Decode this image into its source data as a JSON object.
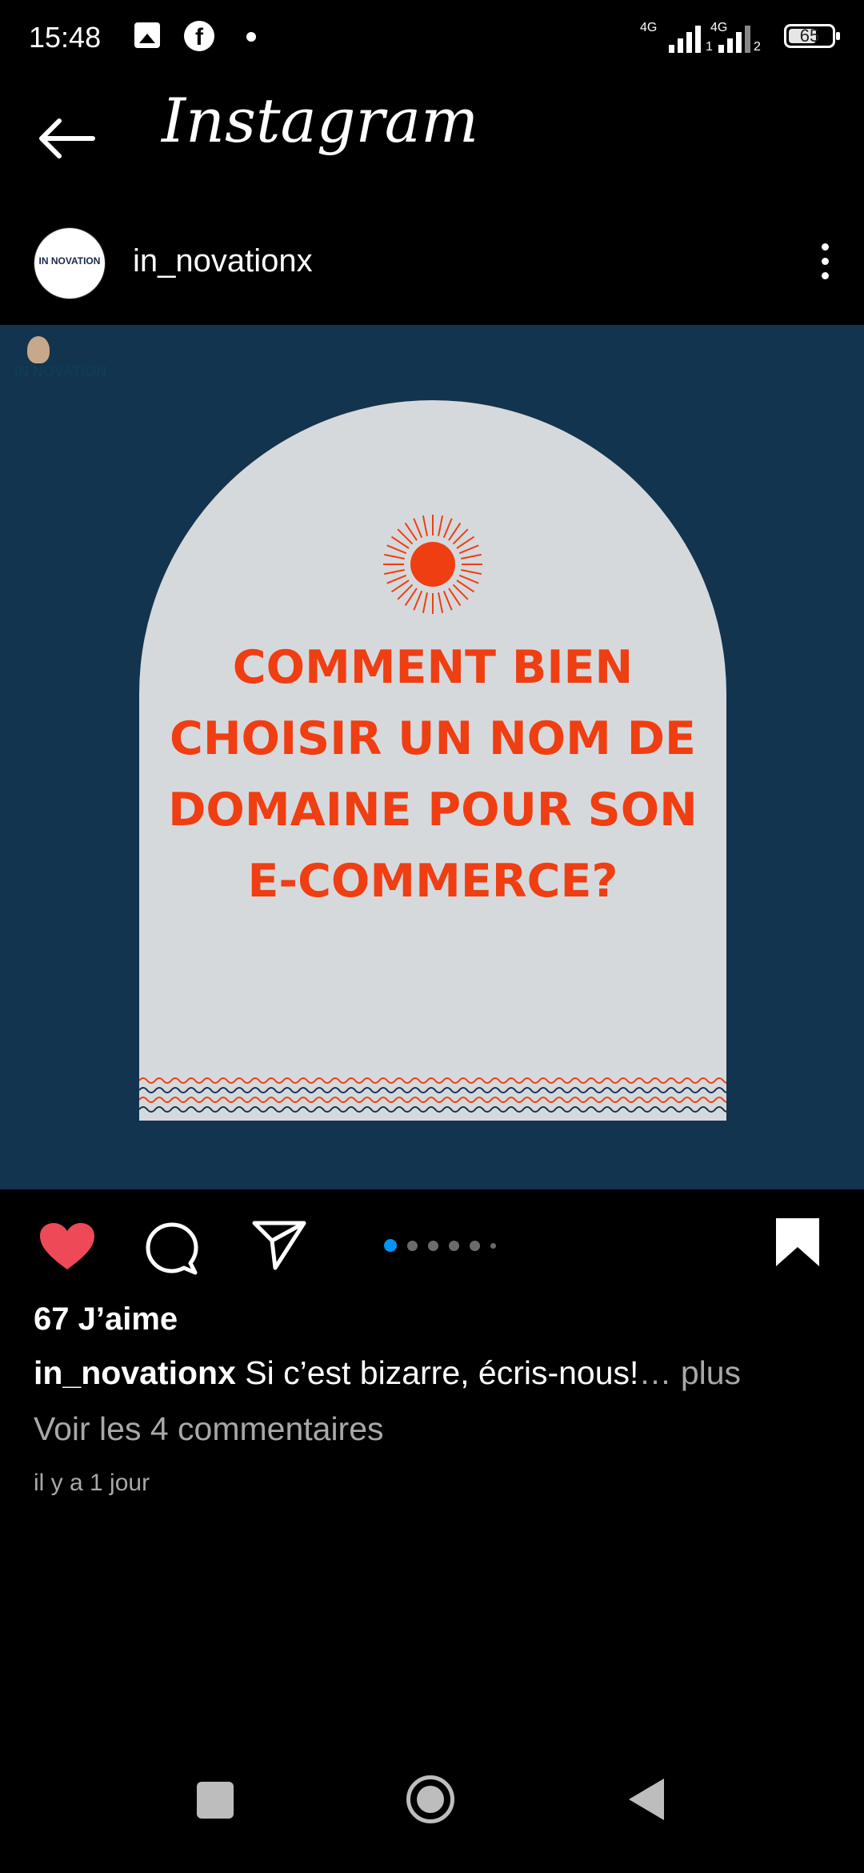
{
  "status_bar": {
    "time": "15:48",
    "network1": "4G",
    "network2": "4G",
    "sim1": "1",
    "sim2": "2",
    "battery": "65",
    "battery_level": 0.65,
    "icons": [
      "gallery-icon",
      "facebook-icon",
      "dot-icon",
      "signal-icon",
      "battery-icon"
    ]
  },
  "appbar": {
    "title": "Instagram",
    "back_icon": "arrow-left-icon"
  },
  "post": {
    "username": "in_novationx",
    "avatar_text": "IN NOVATION",
    "watermark": "IN NOVATION",
    "headline_lines": [
      "COMMENT BIEN",
      "CHOISIR UN NOM DE",
      "DOMAINE POUR SON",
      "E-COMMERCE?"
    ],
    "carousel_count": 6,
    "carousel_active": 0,
    "likes": "67 J’aime",
    "caption_user": "in_novationx",
    "caption_text": " Si c’est bizarre, écris-nous!",
    "caption_more": "… plus",
    "comments_link": "Voir les 4 commentaires",
    "time_ago": "il y a 1 jour",
    "liked": true,
    "saved": true
  },
  "colors": {
    "background": "#000000",
    "post_bg": "#12344f",
    "arch": "#d6d9dc",
    "headline": "#ef3e12",
    "like": "#ed4956",
    "carousel_active": "#0095f6",
    "secondary_text": "#a8a8a8"
  },
  "navbar": {
    "icons": [
      "recents-square-icon",
      "home-circle-icon",
      "back-triangle-icon"
    ]
  }
}
